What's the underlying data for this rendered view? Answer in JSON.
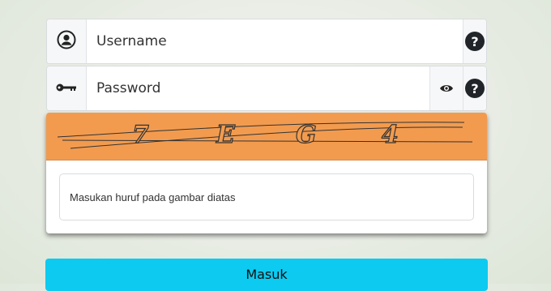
{
  "form": {
    "username": {
      "placeholder": "Username",
      "help_label": "?"
    },
    "password": {
      "placeholder": "Password",
      "help_label": "?"
    },
    "captcha": {
      "characters": [
        "7",
        "E",
        "G",
        "4"
      ],
      "background_color": "#f29b4f",
      "input_placeholder": "Masukan huruf pada gambar diatas"
    },
    "submit_label": "Masuk"
  },
  "icons": {
    "username": "user-circle-icon",
    "password": "key-icon",
    "show_password": "eye-icon",
    "help": "question-circle-icon"
  },
  "colors": {
    "submit_button": "#0dcaf0",
    "help_icon": "#212529"
  }
}
